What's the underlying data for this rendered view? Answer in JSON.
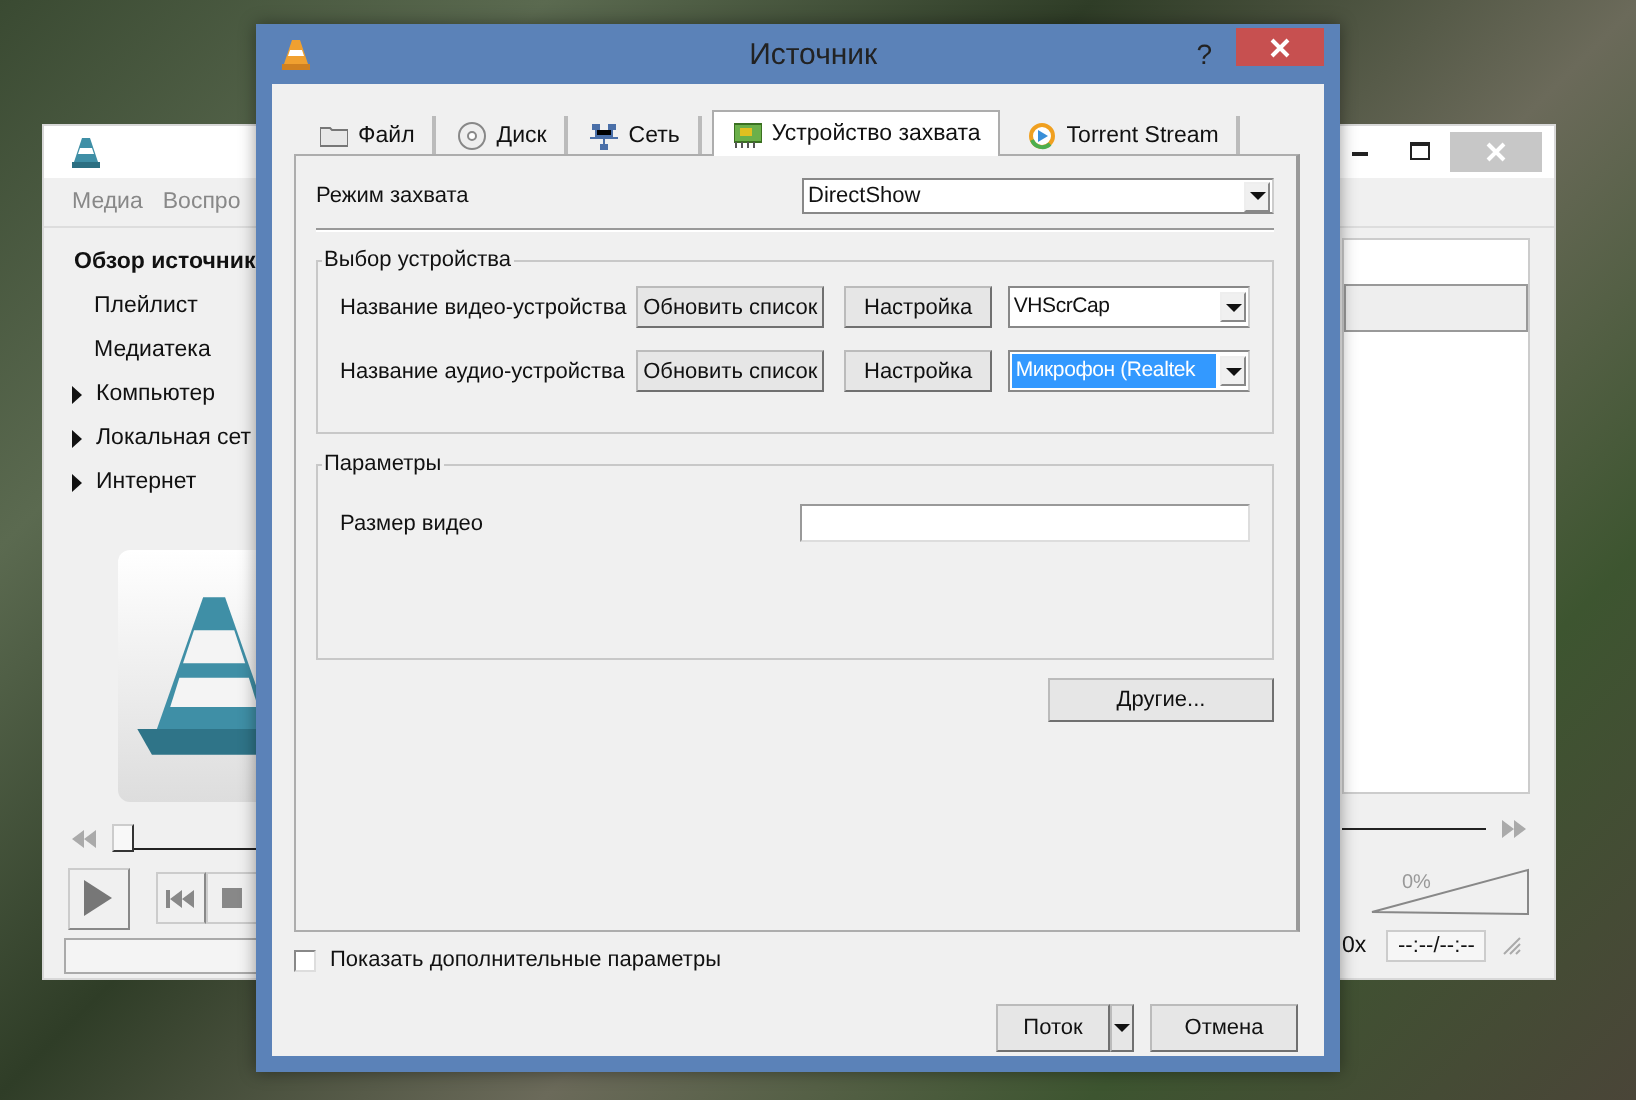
{
  "background_window": {
    "menu": [
      "Медиа",
      "Воспро"
    ],
    "sidebar": [
      {
        "label": "Обзор источник",
        "kind": "header"
      },
      {
        "label": "Плейлист",
        "kind": "item"
      },
      {
        "label": "Медиатека",
        "kind": "item"
      },
      {
        "label": "Компьютер",
        "kind": "group",
        "expanded": false
      },
      {
        "label": "Локальная сет",
        "kind": "group",
        "expanded": false
      },
      {
        "label": "Интернет",
        "kind": "group",
        "expanded": false
      }
    ],
    "seek": {
      "level": 0
    },
    "volume": {
      "level": 0,
      "reading": "0%"
    },
    "speed": "0x",
    "time": "--:--/--:--"
  },
  "dialog": {
    "title": "Источник",
    "help": "?",
    "tabs": [
      {
        "label": "Файл",
        "kind": "folder",
        "selected": false
      },
      {
        "label": "Диск",
        "kind": "disc",
        "selected": false
      },
      {
        "label": "Сеть",
        "kind": "network",
        "selected": false
      },
      {
        "label": "Устройство захвата",
        "kind": "capture",
        "selected": true
      },
      {
        "label": "Torrent Stream",
        "kind": "torrent",
        "selected": false
      }
    ],
    "capture_mode": {
      "label": "Режим захвата",
      "value": "DirectShow"
    },
    "device_group": {
      "title": "Выбор устройства",
      "rows": [
        {
          "label": "Название видео-устройства",
          "refresh": "Обновить список",
          "settings": "Настройка",
          "value": "VHScrCap",
          "selected": false
        },
        {
          "label": "Название аудио-устройства",
          "refresh": "Обновить список",
          "settings": "Настройка",
          "value": "Микрофон (Realtek",
          "selected": true
        }
      ]
    },
    "params_group": {
      "title": "Параметры",
      "rows": [
        {
          "label": "Размер видео"
        }
      ]
    },
    "more_button": "Другие...",
    "show_more": {
      "label": "Показать дополнительные параметры",
      "checked": false
    },
    "buttons": [
      {
        "label": "Поток",
        "kind": "split"
      },
      {
        "label": "Отмена",
        "kind": "plain"
      }
    ]
  }
}
